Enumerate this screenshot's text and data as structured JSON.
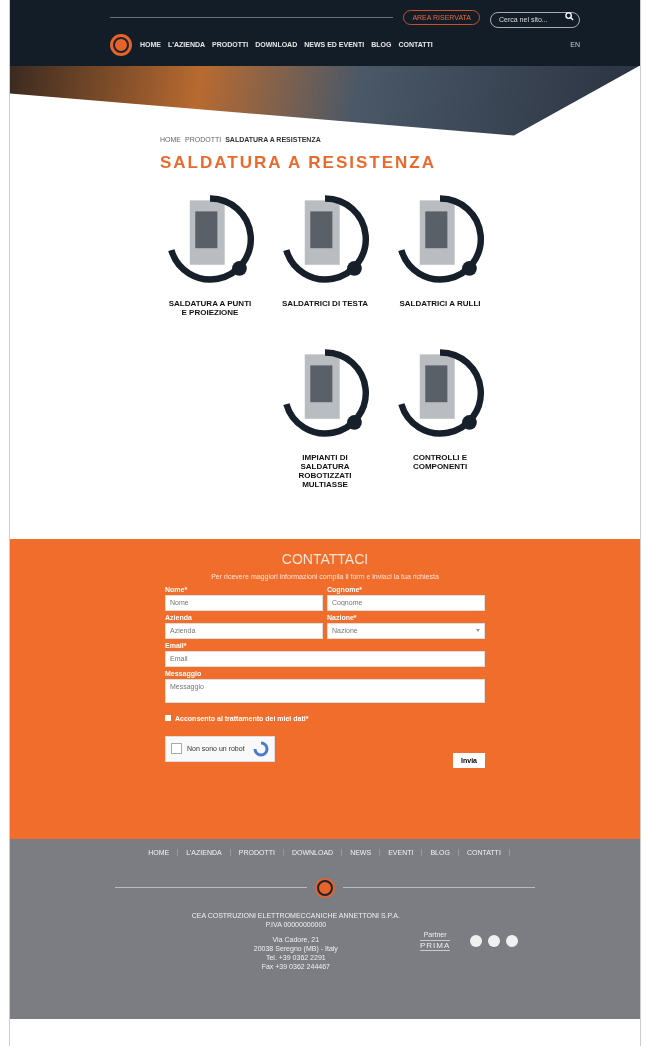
{
  "header": {
    "reserved_button": "AREA RISERVATA",
    "search": {
      "placeholder": "Cerca nel sito..."
    },
    "nav": [
      {
        "label": "HOME",
        "selected": false
      },
      {
        "label": "L'AZIENDA",
        "selected": false
      },
      {
        "label": "PRODOTTI",
        "selected": false
      },
      {
        "label": "DOWNLOAD",
        "selected": false
      },
      {
        "label": "NEWS ED EVENTI",
        "selected": false
      },
      {
        "label": "BLOG",
        "selected": false
      },
      {
        "label": "CONTATTI",
        "selected": false
      }
    ],
    "language": "EN"
  },
  "breadcrumb": [
    {
      "label": "HOME"
    },
    {
      "label": "PRODOTTI"
    },
    {
      "label": "SALDATURA A RESISTENZA"
    }
  ],
  "title": "SALDATURA A RESISTENZA",
  "products": [
    {
      "name": "SALDATURA A PUNTI E PROIEZIONE"
    },
    {
      "name": "SALDATRICI DI TESTA"
    },
    {
      "name": "SALDATRICI A RULLI"
    },
    {
      "name": "IMPIANTI DI SALDATURA ROBOTIZZATI MULTIASSE"
    },
    {
      "name": "CONTROLLI E COMPONENTI"
    }
  ],
  "contact": {
    "title": "CONTATTACI",
    "intro": "Per ricevere maggiori informazioni compila il form e inviaci la tua richiesta",
    "fields": [
      {
        "label": "Nome*",
        "placeholder": "Nome",
        "kind": "half"
      },
      {
        "label": "Cognome*",
        "placeholder": "Cognome",
        "kind": "half"
      },
      {
        "label": "Azienda",
        "placeholder": "Azienda",
        "kind": "half"
      },
      {
        "label": "Nazione*",
        "placeholder": "Nazione",
        "kind": "select"
      },
      {
        "label": "Email*",
        "placeholder": "Email",
        "kind": "full"
      },
      {
        "label": "Messaggio",
        "placeholder": "Messaggio",
        "kind": "area"
      }
    ],
    "privacy": "Acconsento al trattamento dei miei dati*",
    "privacy_checked": false,
    "captcha": "Non sono un robot",
    "captcha_checked": false,
    "submit": "Invia"
  },
  "footer": {
    "nav": [
      "HOME",
      "L'AZIENDA",
      "PRODOTTI",
      "DOWNLOAD",
      "NEWS",
      "EVENTI",
      "BLOG",
      "CONTATTI"
    ],
    "company": "CEA COSTRUZIONI ELETTROMECCANICHE ANNETTONI S.P.A.",
    "vat": "P.IVA 00000000000",
    "address": [
      "Via Cadore, 21",
      "20038 Seregno (MB) - Italy",
      "Tel. +39 0362 2291",
      "Fax +39 0362 244467"
    ],
    "partner_label": "Partner",
    "partner": "PRIMA"
  }
}
